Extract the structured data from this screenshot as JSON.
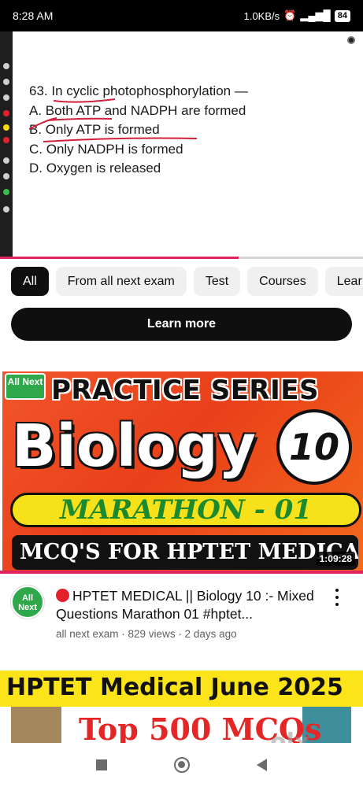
{
  "status_bar": {
    "time": "8:28 AM",
    "network_speed": "1.0KB/s",
    "battery": "84"
  },
  "player": {
    "question_lines": [
      "63. In cyclic photophosphorylation —",
      "A. Both ATP and NADPH are formed",
      "B. Only ATP is formed",
      "C. Only NADPH is formed",
      "D. Oxygen is released"
    ],
    "progress": 0.657
  },
  "chips": [
    "All",
    "From all next exam",
    "Test",
    "Courses",
    "Lear"
  ],
  "learn_more": "Learn more",
  "video": {
    "thumbnail": {
      "logo": "All Next",
      "line1": "PRACTICE SERIES",
      "line2": "Biology",
      "badge": "10",
      "line3": "MARATHON - 01",
      "line4": "MCQ'S FOR HPTET MEDICAL",
      "duration": "1:09:28"
    },
    "channel_avatar": "All Next",
    "title": "HPTET MEDICAL || Biology 10 :- Mixed Questions Marathon 01 #hptet...",
    "meta": "all next exam · 829 views · 2 days ago"
  },
  "next_video": {
    "line1": "HPTET Medical June 2025",
    "line2": "Top 500 MCQs"
  },
  "watermark": "olx",
  "colors": {
    "accent": "#e0245e",
    "chip_active": "#0f0f0f",
    "chip_bg": "#f0f0f0",
    "thumb_orange": "#f2552a",
    "marathon_green": "#1b8a2e",
    "band_yellow": "#fbe419"
  }
}
